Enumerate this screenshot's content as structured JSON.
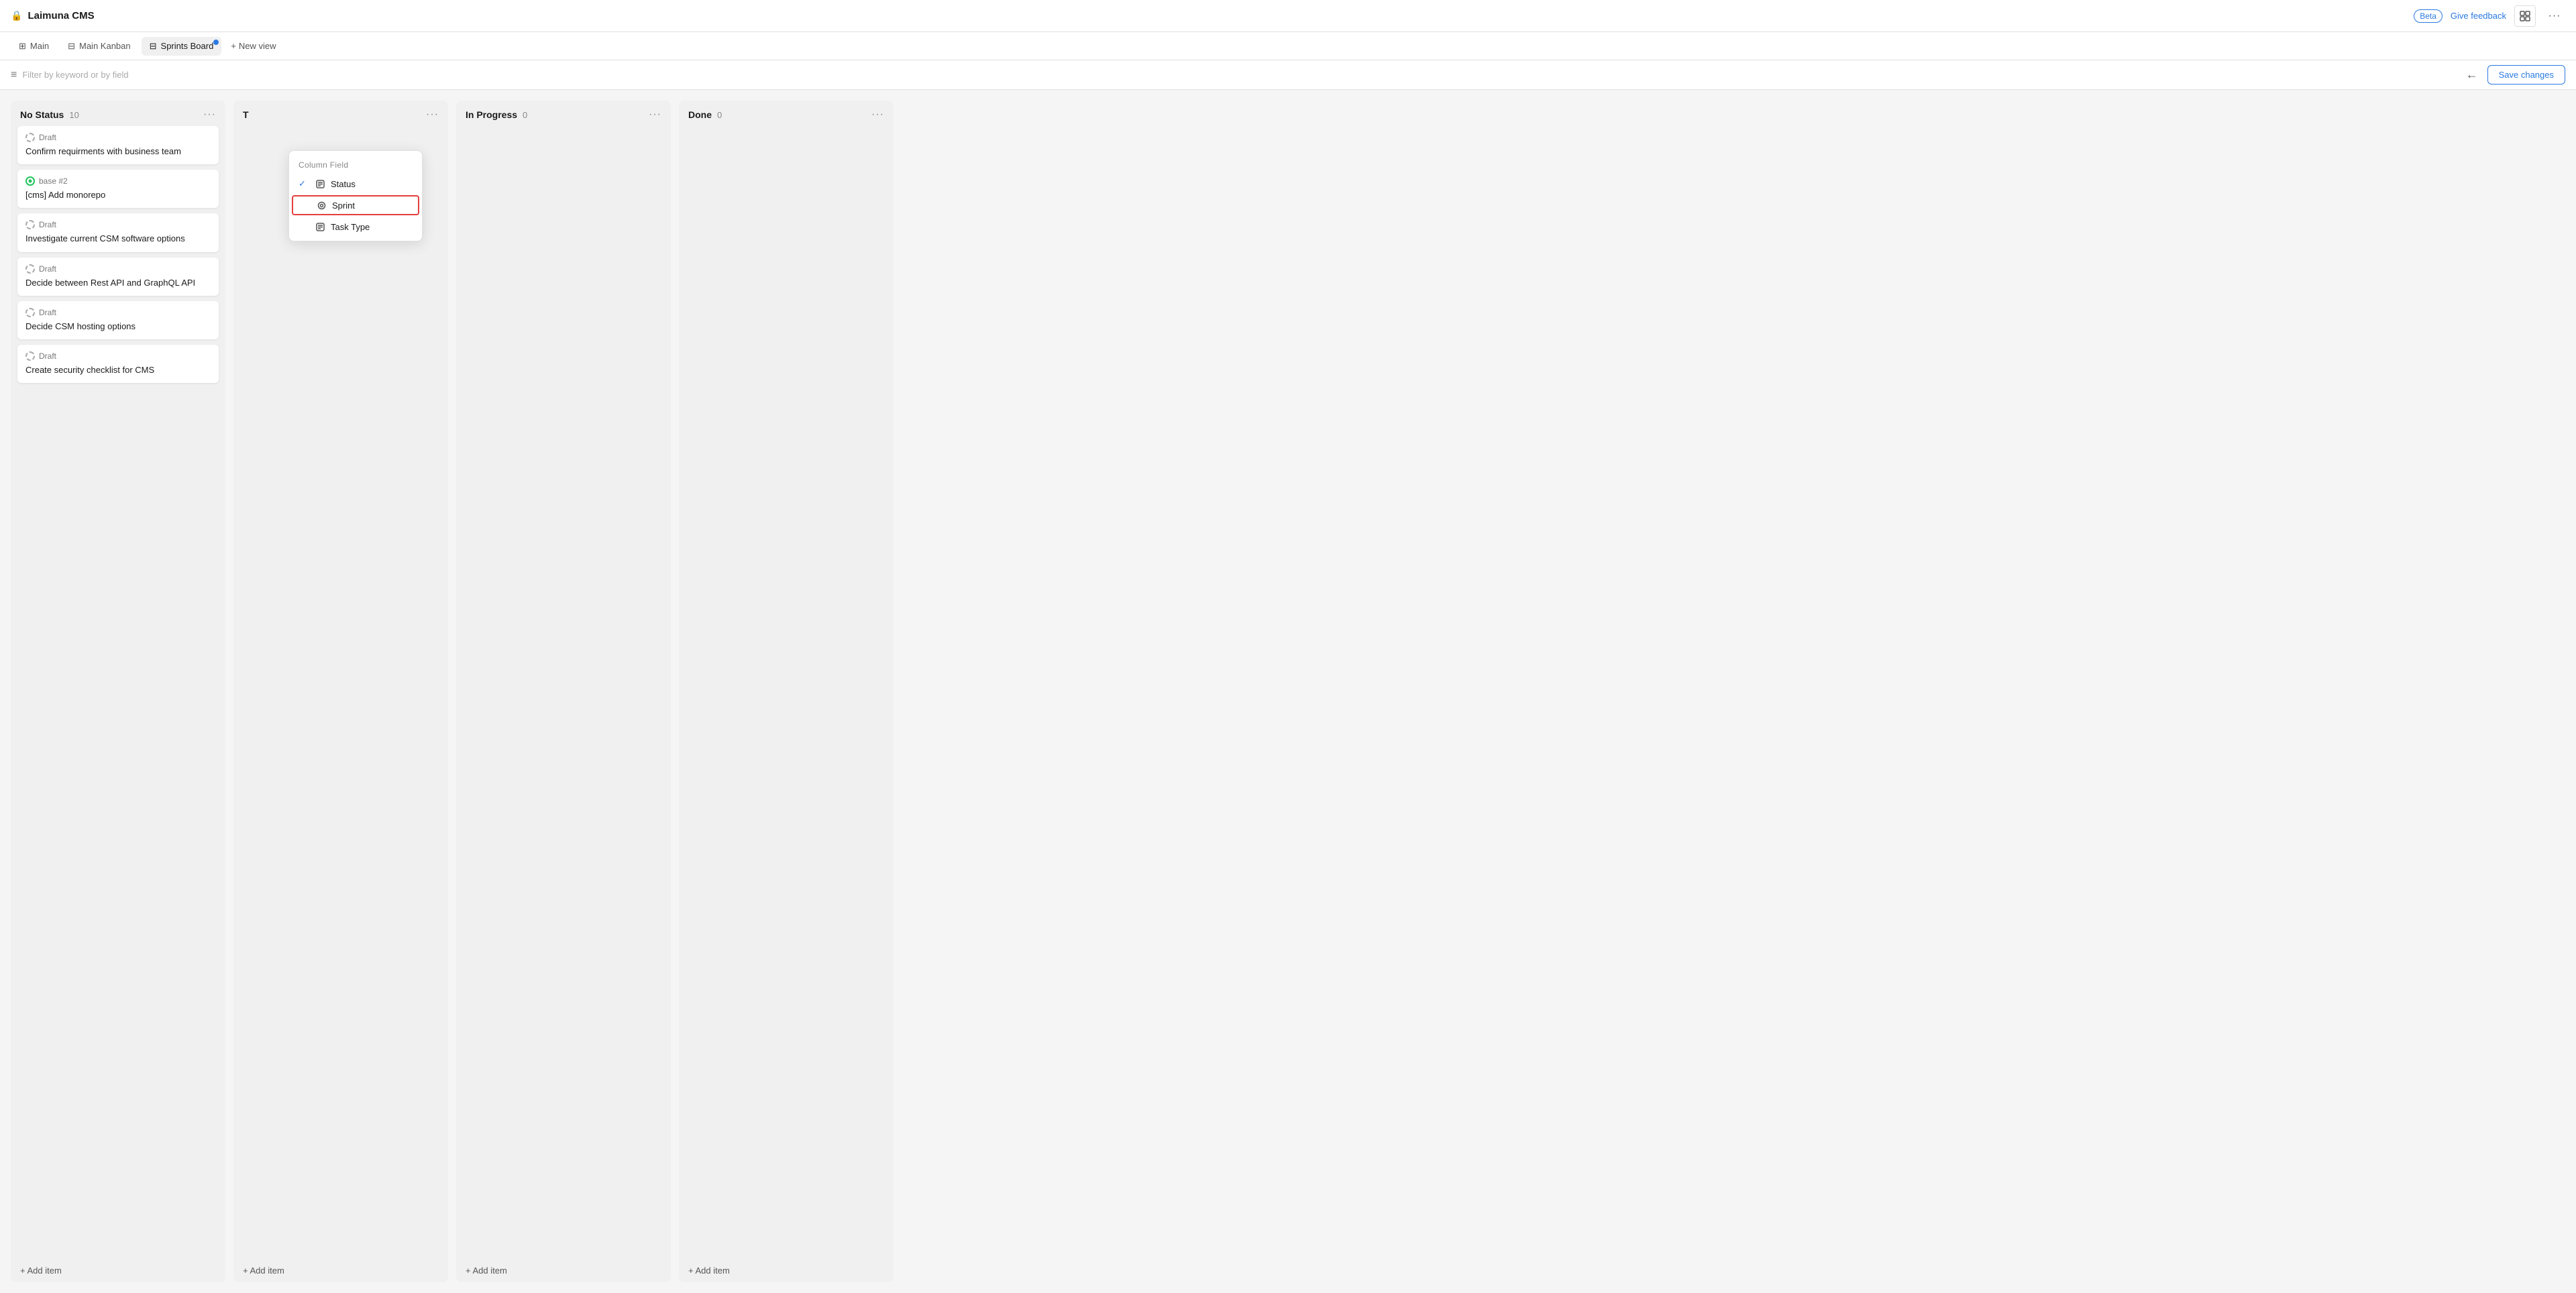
{
  "app": {
    "title": "Laimuna CMS",
    "lock_icon": "🔒"
  },
  "topbar": {
    "beta_label": "Beta",
    "feedback_label": "Give feedback",
    "layout_icon": "⊞",
    "more_icon": "···"
  },
  "tabs": [
    {
      "id": "main",
      "label": "Main",
      "icon": "⊞",
      "active": false
    },
    {
      "id": "main-kanban",
      "label": "Main Kanban",
      "icon": "⊟",
      "active": false
    },
    {
      "id": "sprints-board",
      "label": "Sprints Board",
      "icon": "⊟",
      "active": true,
      "dot": true
    }
  ],
  "new_view": {
    "label": "New view",
    "plus_icon": "+"
  },
  "filter_bar": {
    "filter_icon": "≡",
    "filter_placeholder": "Filter by keyword or by field",
    "back_icon": "←",
    "save_label": "Save changes"
  },
  "dropdown": {
    "header": "Column Field",
    "items": [
      {
        "id": "status",
        "label": "Status",
        "icon": "⊟",
        "checked": true,
        "highlighted": false
      },
      {
        "id": "sprint",
        "label": "Sprint",
        "icon": "🔍",
        "checked": false,
        "highlighted": true
      },
      {
        "id": "task-type",
        "label": "Task Type",
        "icon": "⊟",
        "checked": false,
        "highlighted": false
      }
    ]
  },
  "columns": [
    {
      "id": "no-status",
      "title": "No Status",
      "count": 10,
      "cards": [
        {
          "id": 1,
          "status": "Draft",
          "status_type": "draft",
          "title": "Confirm requirments with business team"
        },
        {
          "id": 2,
          "status": "base #2",
          "status_type": "base",
          "title": "[cms] Add monorepo"
        },
        {
          "id": 3,
          "status": "Draft",
          "status_type": "draft",
          "title": "Investigate current CSM software options"
        },
        {
          "id": 4,
          "status": "Draft",
          "status_type": "draft",
          "title": "Decide between Rest API and GraphQL API"
        },
        {
          "id": 5,
          "status": "Draft",
          "status_type": "draft",
          "title": "Decide CSM hosting options"
        },
        {
          "id": 6,
          "status": "Draft",
          "status_type": "draft",
          "title": "Create security checklist for CMS"
        }
      ],
      "add_item": "+ Add item"
    },
    {
      "id": "todo",
      "title": "T",
      "count": null,
      "cards": [],
      "add_item": "+ Add item"
    },
    {
      "id": "in-progress",
      "title": "In Progress",
      "count": 0,
      "cards": [],
      "add_item": "+ Add item"
    },
    {
      "id": "done",
      "title": "Done",
      "count": 0,
      "cards": [],
      "add_item": "+ Add item"
    }
  ]
}
